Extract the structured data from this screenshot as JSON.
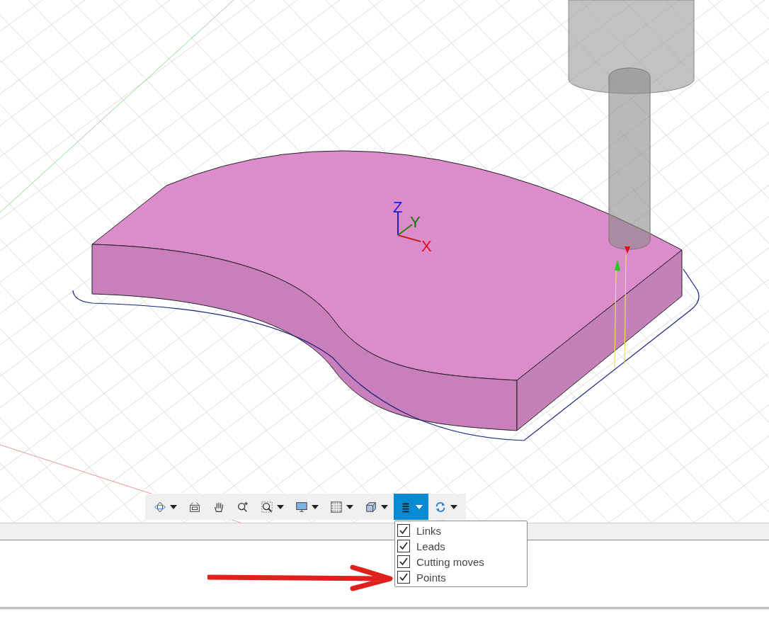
{
  "viewport": {
    "axis_labels": [
      {
        "kind": "z",
        "text": "Z"
      },
      {
        "kind": "y",
        "text": "Y"
      },
      {
        "kind": "x",
        "text": "X"
      }
    ]
  },
  "toolbar": {
    "buttons": [
      {
        "kind": "orbit",
        "dropdown": true,
        "selected": false
      },
      {
        "kind": "look-at",
        "dropdown": false,
        "selected": false
      },
      {
        "kind": "pan",
        "dropdown": false,
        "selected": false
      },
      {
        "kind": "zoom",
        "dropdown": false,
        "selected": false
      },
      {
        "kind": "fit",
        "dropdown": true,
        "selected": false
      },
      {
        "kind": "display",
        "dropdown": true,
        "selected": false
      },
      {
        "kind": "grid",
        "dropdown": true,
        "selected": false
      },
      {
        "kind": "view",
        "dropdown": true,
        "selected": false
      },
      {
        "kind": "toolpath",
        "dropdown": true,
        "selected": true
      },
      {
        "kind": "refresh",
        "dropdown": true,
        "selected": false
      }
    ]
  },
  "menu": {
    "items": [
      {
        "label": "Links",
        "checked": true
      },
      {
        "label": "Leads",
        "checked": true
      },
      {
        "label": "Cutting moves",
        "checked": true
      },
      {
        "label": "Points",
        "checked": true
      }
    ]
  }
}
